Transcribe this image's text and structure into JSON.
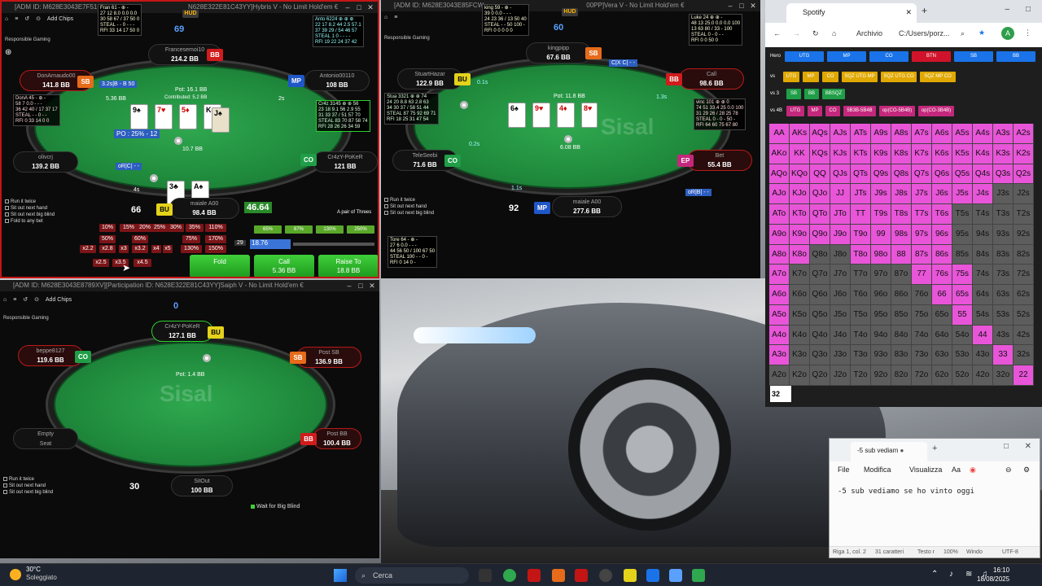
{
  "wallpaper": {
    "name": "car-desktop-wallpaper"
  },
  "table1": {
    "title": "[ADM ID: M628E3043E7F51HU] [Participation ID: N628E322E81C43YY] Hybris V - No Limit Hold'em €",
    "title_short": "[ADM ID: M628E3043E7F51HU",
    "title_mid": "N628E322E81C43YY]Hybris V - No Limit Hold'em €",
    "hud_tag": "HUD",
    "add_chips": "Add Chips",
    "responsible": "Responsible Gaming",
    "hand_counter": "69",
    "pot": "Pot: 16.1 BB",
    "contributed": "Contributed: 5.2 BB",
    "po_text": "PO : 25% - 12",
    "bet_hint": "3.2s|B - B 50",
    "or_text": "oR|C| - -",
    "timer_2s": "2s",
    "timer_4s": "4s",
    "stack_10_7": "10.7 BB",
    "stack_5_36": "5.36 BB",
    "hero_stack_green": "46.64",
    "hand_desc": "A pair of Threes",
    "counter66": "66",
    "players": [
      {
        "name": "Francesemoi10",
        "stack": "214.2 BB",
        "pos": "BB"
      },
      {
        "name": "DonArnaudo00",
        "stack": "141.8 BB",
        "pos": "SB"
      },
      {
        "name": "Antonio00110",
        "stack": "108 BB",
        "pos": "MP"
      },
      {
        "name": "olivcrj",
        "stack": "139.2 BB",
        "pos": ""
      },
      {
        "name": "Cr4zY-PoKeR",
        "stack": "121 BB",
        "pos": "CO"
      },
      {
        "name": "maiale A00",
        "stack": "98.4 BB",
        "pos": "BU"
      }
    ],
    "board": [
      "9♠",
      "7♥",
      "5♦",
      "K♠",
      "J♠"
    ],
    "hero_cards": [
      "3♣",
      "A♠"
    ],
    "hud_fran": "Fran 61 - ⊕ -\n27 12 8.0 0.0 0.0\n30 58 67 / 37 50 0\nSTEAL - - 0 - - -\nRFI 33 14 17 50 0",
    "hud_anto": "Anto 6224 ⊕ ⊕ ⊕\n22 17 8.2 44 2.5 57.1\n37 39 29 / 54 46 57\nSTEAL 1 0 - - - -\nRFI 19 22 24 37 42",
    "hud_dona": "DonA 45 - ⊕ -\n58 7 0.0 - - -\n36 42 40 / 17 37 17\nSTEAL - - 0 - -\nRFI 0 33 14 0 0",
    "hud_cr4z": "Cr4z 3145 ⊕ ⊕ 56\n23 18 9.1 56 2.9 55\n31 33 37 / 51 57 70\nSTEAL 83 70 87 58 74\nRFI 28 26 26 34 59",
    "sizes_row1": [
      "10%",
      "15%",
      "20%",
      "25%",
      "30%",
      "35%",
      "110%"
    ],
    "sizes_row2": [
      "50%",
      "60%",
      "75%",
      "170%"
    ],
    "sizes_row3": [
      "x2.2",
      "x2.8",
      "x3",
      "x3.2",
      "x4",
      "x5",
      "130%",
      "150%"
    ],
    "sizes_row4": [
      "x2.5",
      "x3.5",
      "x4.5"
    ],
    "green_pcts": [
      "65%",
      "87%",
      "130%",
      "250%"
    ],
    "bet_slider_val": "29",
    "bet_input": "18.76",
    "fold": "Fold",
    "call": "Call",
    "call_amt": "5.36 BB",
    "raise": "Raise To",
    "raise_amt": "18.8 BB",
    "checks": [
      "Run it twice",
      "Sit out next hand",
      "Sit out next big blind",
      "Fold to any bet"
    ]
  },
  "table2": {
    "title": "[ADM ID: M628E3043E85FCW",
    "title_mid": "00PP]Vera V - No Limit Hold'em €",
    "hud_tag": "HUD",
    "hand_counter": "60",
    "pot": "Pot: 11.8 BB",
    "stack_6_08": "6.08 BB",
    "timer_0_1": "0.1s",
    "timer_1_3": "1.3s",
    "timer_0_2": "0.2s",
    "timer_1_1": "1.1s",
    "cx_text": "C|X C| - -",
    "or_text": "oR|B| - -",
    "counter92": "92",
    "players": [
      {
        "name": "kingpipp",
        "stack": "67.6 BB",
        "pos": "SB"
      },
      {
        "name": "StuartHazar",
        "stack": "122.9 BB",
        "pos": "BU"
      },
      {
        "name": "Call",
        "stack": "98.6 BB",
        "pos": "BB"
      },
      {
        "name": "TeleSeebi",
        "stack": "71.6 BB",
        "pos": "CO"
      },
      {
        "name": "Bet",
        "stack": "55.4 BB",
        "pos": "EP"
      },
      {
        "name": "maiale A00",
        "stack": "277.6 BB",
        "pos": "MP"
      }
    ],
    "board": [
      "6♠",
      "9♥",
      "4♦",
      "8♥"
    ],
    "hud_king": "king 59 - ⊕ -\n39 0 0.0 - - -\n24 23 36 / 13 50 40\nSTEAL - - 50 100 -\nRFI 0 0 0 0 0",
    "hud_luke": "Luke 24 ⊕ ⊕ -\n48 13 25.0 0.0 0.0 100\n13 63 80 / 33 - 100\nSTEAL 0 - 0 - -\nRFI 0 0 50 0",
    "hud_stua": "Stua 3321 ⊕ ⊕ 74\n24 20 8.8 63 2.8 63\n34 30 37 / 58 51 44\nSTEAL 87 75 92 69 71\nRFI 18 25 31 47 54",
    "hud_vinc": "vinc 101 ⊕ ⊕ 0\n74 51 33.4 25 0.0 100\n31 29 26 / 28 25 78\nSTEAL 0 - 0 - 50 -\nRFI 64 60 75 67 80",
    "hud_tore": "Tore 64 - ⊕ -\n27 6 0.0 - - -\n44 56 50 / 100 67 50\nSTEAL 100 - - 0 -\nRFI 0 14 0 -",
    "checks": [
      "Run it twice",
      "Sit out next hand",
      "Sit out next big blind"
    ]
  },
  "table3": {
    "title": "[ADM ID: M628E3043E8789XV][Participation ID: N628E322E81C43YY]Saiph V - No Limit Hold'em €",
    "add_chips": "Add Chips",
    "responsible": "Responsible Gaming",
    "hand_counter": "0",
    "pot": "Pot: 1.4 BB",
    "logo": "Sisal",
    "counter30": "30",
    "players": [
      {
        "name": "Cr4zY-PoKeR",
        "stack": "127.1 BB",
        "pos": "BU"
      },
      {
        "name": "beppe8127",
        "stack": "119.6 BB",
        "pos": "CO"
      },
      {
        "name": "Post SB",
        "stack": "136.9 BB",
        "pos": "SB"
      },
      {
        "name": "Post BB",
        "stack": "100.4 BB",
        "pos": "BB"
      },
      {
        "name": "SitOut",
        "stack": "100 BB",
        "pos": ""
      }
    ],
    "empty_seat": "Empty\nSeat",
    "empty1": "Empty",
    "empty2": "Seat",
    "wait_bb": "Wait for Big Blind",
    "checks": [
      "Run it twice",
      "Sit out next hand",
      "Sit out next big blind"
    ]
  },
  "browser": {
    "tab_title": "Spotify",
    "archivio": "Archivio",
    "address": "C:/Users/porz...",
    "avatar": "A",
    "row_hero_label": "Hero",
    "row_hero": [
      "UTG",
      "MP",
      "CO",
      "BTN",
      "SB",
      "BB"
    ],
    "row_vs_label": "vs",
    "row_vs": [
      "UTG",
      "MP",
      "CO",
      "SQZ UTG MP",
      "SQZ UTG CO",
      "SQZ MP CO"
    ],
    "row_vs3_label": "vs 3",
    "row_vs3": [
      "SB",
      "BB",
      "BBSQZ"
    ],
    "row_vs4_label": "vs 4B",
    "row_vs4": [
      "UTG",
      "MP",
      "CO",
      "5B3B-5B4B",
      "op(CO-5B4B)",
      "op(CO-3B4B)"
    ],
    "grid": [
      [
        "AA",
        "AKs",
        "AQs",
        "AJs",
        "ATs",
        "A9s",
        "A8s",
        "A7s",
        "A6s",
        "A5s",
        "A4s",
        "A3s",
        "A2s"
      ],
      [
        "AKo",
        "KK",
        "KQs",
        "KJs",
        "KTs",
        "K9s",
        "K8s",
        "K7s",
        "K6s",
        "K5s",
        "K4s",
        "K3s",
        "K2s"
      ],
      [
        "AQo",
        "KQo",
        "QQ",
        "QJs",
        "QTs",
        "Q9s",
        "Q8s",
        "Q7s",
        "Q6s",
        "Q5s",
        "Q4s",
        "Q3s",
        "Q2s"
      ],
      [
        "AJo",
        "KJo",
        "QJo",
        "JJ",
        "JTs",
        "J9s",
        "J8s",
        "J7s",
        "J6s",
        "J5s",
        "J4s",
        "J3s",
        "J2s"
      ],
      [
        "ATo",
        "KTo",
        "QTo",
        "JTo",
        "TT",
        "T9s",
        "T8s",
        "T7s",
        "T6s",
        "T5s",
        "T4s",
        "T3s",
        "T2s"
      ],
      [
        "A9o",
        "K9o",
        "Q9o",
        "J9o",
        "T9o",
        "99",
        "98s",
        "97s",
        "96s",
        "95s",
        "94s",
        "93s",
        "92s"
      ],
      [
        "A8o",
        "K8o",
        "Q8o",
        "J8o",
        "T8o",
        "98o",
        "88",
        "87s",
        "86s",
        "85s",
        "84s",
        "83s",
        "82s"
      ],
      [
        "A7o",
        "K7o",
        "Q7o",
        "J7o",
        "T7o",
        "97o",
        "87o",
        "77",
        "76s",
        "75s",
        "74s",
        "73s",
        "72s"
      ],
      [
        "A6o",
        "K6o",
        "Q6o",
        "J6o",
        "T6o",
        "96o",
        "86o",
        "76o",
        "66",
        "65s",
        "64s",
        "63s",
        "62s"
      ],
      [
        "A5o",
        "K5o",
        "Q5o",
        "J5o",
        "T5o",
        "95o",
        "85o",
        "75o",
        "65o",
        "55",
        "54s",
        "53s",
        "52s"
      ],
      [
        "A4o",
        "K4o",
        "Q4o",
        "J4o",
        "T4o",
        "94o",
        "84o",
        "74o",
        "64o",
        "54o",
        "44",
        "43s",
        "42s"
      ],
      [
        "A3o",
        "K3o",
        "Q3o",
        "J3o",
        "T3o",
        "93o",
        "83o",
        "73o",
        "63o",
        "53o",
        "43o",
        "33",
        "32s"
      ],
      [
        "A2o",
        "K2o",
        "Q2o",
        "J2o",
        "T2o",
        "92o",
        "82o",
        "72o",
        "62o",
        "52o",
        "42o",
        "32o",
        "22"
      ]
    ],
    "combo_count": "32"
  },
  "notepad": {
    "tab_title": "-5 sub vediam",
    "menu": [
      "File",
      "Modifica",
      "Visualizza"
    ],
    "content": "-5 sub vediamo se ho vinto oggi",
    "status": [
      "Riga 1, col. 2",
      "31 caratteri",
      "Testo r",
      "100%",
      "Windo",
      "UTF-8"
    ]
  },
  "taskbar": {
    "weather_temp": "30°C",
    "weather_desc": "Soleggiato",
    "search": "Cerca",
    "time": "16:10",
    "date": "18/08/2025"
  }
}
